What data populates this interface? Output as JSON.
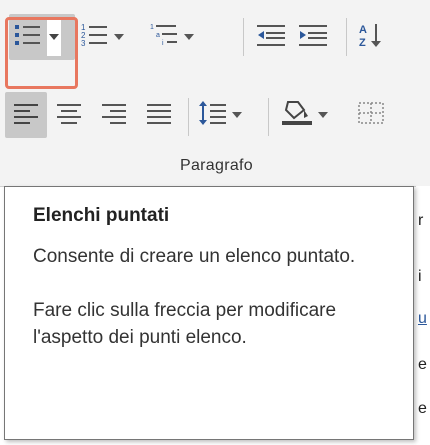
{
  "ribbon": {
    "group_label": "Paragrafo",
    "row1": [
      {
        "name": "bullets-icon",
        "has_arrow": true,
        "highlighted": true
      },
      {
        "name": "numbering-icon",
        "has_arrow": true
      },
      {
        "name": "multilevel-list-icon",
        "has_arrow": true
      },
      {
        "name": "decrease-indent-icon",
        "has_arrow": false
      },
      {
        "name": "increase-indent-icon",
        "has_arrow": false
      },
      {
        "name": "sort-icon",
        "has_arrow": false
      }
    ],
    "row2": [
      {
        "name": "align-left-icon",
        "selected": true
      },
      {
        "name": "align-center-icon"
      },
      {
        "name": "align-right-icon"
      },
      {
        "name": "justify-icon"
      },
      {
        "name": "line-spacing-icon",
        "has_arrow": true
      },
      {
        "name": "shading-icon",
        "has_arrow": true
      },
      {
        "name": "borders-icon"
      }
    ],
    "accent_color": "#2b579a",
    "highlight_color": "#e8775f"
  },
  "tooltip": {
    "title": "Elenchi puntati",
    "description": "Consente di creare un elenco puntato.",
    "hint": "Fare clic sulla freccia per modificare l'aspetto dei punti elenco."
  },
  "background_edge": {
    "chars": [
      "r",
      "i",
      "u",
      "e",
      "e"
    ]
  }
}
